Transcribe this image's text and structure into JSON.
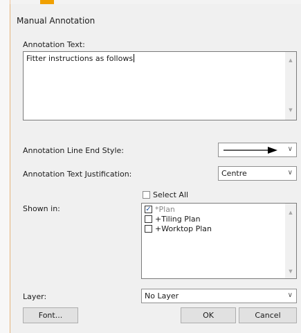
{
  "dialog": {
    "title": "Manual Annotation",
    "annotation_text_label": "Annotation Text:",
    "annotation_text_value": "Fitter instructions as follows",
    "line_end_label": "Annotation Line End Style:",
    "line_end_value_icon": "arrow-right-line",
    "justification_label": "Annotation Text Justification:",
    "justification_value": "Centre",
    "select_all_label": "Select All",
    "select_all_checked": false,
    "shown_in_label": "Shown in:",
    "shown_in_items": [
      {
        "label": "*Plan",
        "checked": true,
        "disabled": true
      },
      {
        "label": "+Tiling Plan",
        "checked": false,
        "disabled": false
      },
      {
        "label": "+Worktop Plan",
        "checked": false,
        "disabled": false
      }
    ],
    "layer_label": "Layer:",
    "layer_value": "No Layer",
    "font_button": "Font...",
    "ok_button": "OK",
    "cancel_button": "Cancel"
  }
}
